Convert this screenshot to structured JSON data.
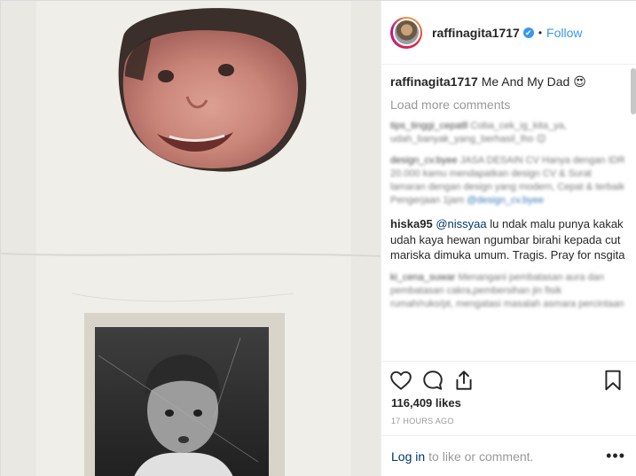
{
  "post": {
    "username": "raffinagita1717",
    "verified_glyph": "✔",
    "separator": "•",
    "follow_label": "Follow",
    "caption_user": "raffinagita1717",
    "caption_text": "Me And My Dad 😍",
    "load_more": "Load more comments",
    "comments_blurred": [
      {
        "user": "tips_tinggi_cepatll",
        "text": "Coba_cek_ig_kita_ya, udah_banyak_yang_berhasil_lho 😊"
      },
      {
        "user": "design_cv.byee",
        "text": "JASA DESAIN CV Hanya dengan IDR 20.000 kamu mendapatkan design CV & Surat lamaran dengan design yang modern, Cepat & terbaik Pengerjaan 1jam",
        "link": "@design_cv.byee"
      }
    ],
    "comment_main": {
      "user": "hiska95",
      "mention": "@nissyaa",
      "text": "lu ndak malu punya kakak udah kaya hewan ngumbar birahi kepada cut mariska dimuka umum. Tragis. Pray for nsgita"
    },
    "comment_blurred_last": {
      "user": "ki_cena_suwar",
      "text": "Menangani pembatasan aura dan pembatasan cakra,pembersihan jin fisik rumah/ruko/pt, mengatasi masalah asmara percintaan"
    },
    "likes": "116,409 likes",
    "time": "17 HOURS AGO",
    "login_label": "Log in",
    "login_rest": "to like or comment.",
    "more_glyph": "•••"
  },
  "icons": [
    "heart-icon",
    "comment-icon",
    "share-icon",
    "bookmark-icon",
    "verified-badge-icon",
    "more-options-icon"
  ],
  "colors": {
    "link_blue": "#3897f0",
    "text": "#262626",
    "muted": "#999999",
    "dark_link": "#003569"
  }
}
